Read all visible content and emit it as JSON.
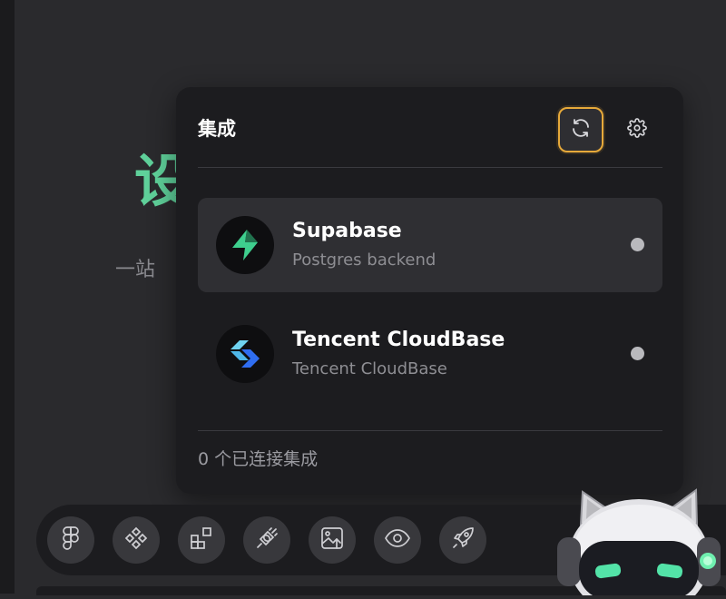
{
  "background": {
    "hero_title": "设",
    "hero_subtitle": "一站"
  },
  "popup": {
    "title": "集成",
    "refresh_icon": "refresh-icon",
    "settings_icon": "gear-icon",
    "items": [
      {
        "name": "Supabase",
        "description": "Postgres backend",
        "icon": "supabase-logo-icon",
        "selected": true,
        "status": "disconnected"
      },
      {
        "name": "Tencent CloudBase",
        "description": "Tencent CloudBase",
        "icon": "cloudbase-logo-icon",
        "selected": false,
        "status": "disconnected"
      }
    ],
    "footer": "0 个已连接集成"
  },
  "toolbar": {
    "buttons": [
      {
        "icon": "figma-icon"
      },
      {
        "icon": "components-icon"
      },
      {
        "icon": "add-widget-icon"
      },
      {
        "icon": "plug-icon"
      },
      {
        "icon": "image-upload-icon"
      },
      {
        "icon": "eye-icon"
      },
      {
        "icon": "rocket-icon"
      }
    ]
  },
  "colors": {
    "accent_border": "#e6a93a",
    "hero_green": "#5fd09a",
    "supabase_green": "#3ecf8e"
  }
}
